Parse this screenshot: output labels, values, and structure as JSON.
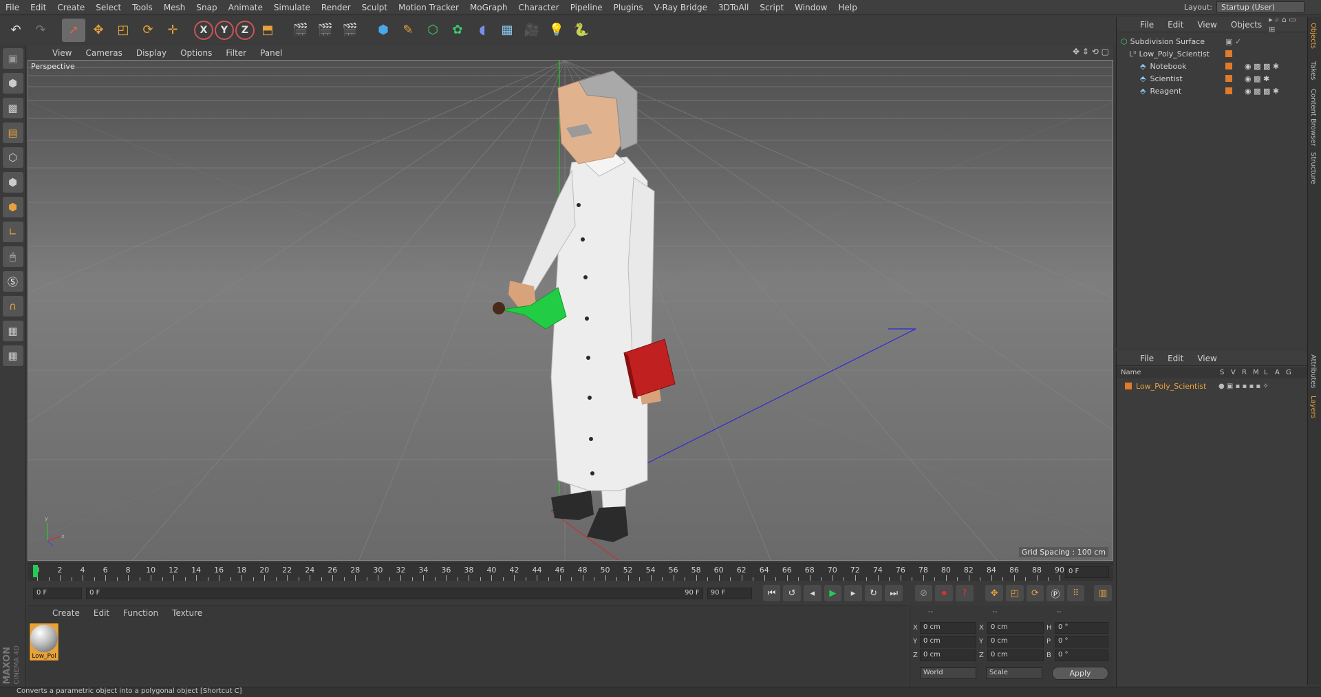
{
  "menu": [
    "File",
    "Edit",
    "Create",
    "Select",
    "Tools",
    "Mesh",
    "Snap",
    "Animate",
    "Simulate",
    "Render",
    "Sculpt",
    "Motion Tracker",
    "MoGraph",
    "Character",
    "Pipeline",
    "Plugins",
    "V-Ray Bridge",
    "3DToAll",
    "Script",
    "Window",
    "Help"
  ],
  "layout": {
    "label": "Layout:",
    "value": "Startup (User)"
  },
  "toolbar": {
    "axes": [
      "X",
      "Y",
      "Z"
    ]
  },
  "viewport": {
    "menu": [
      "View",
      "Cameras",
      "Display",
      "Options",
      "Filter",
      "Panel"
    ],
    "label": "Perspective",
    "grid_spacing": "Grid Spacing : 100 cm"
  },
  "timeline": {
    "ticks": [
      "0",
      "2",
      "4",
      "6",
      "8",
      "10",
      "12",
      "14",
      "16",
      "18",
      "20",
      "22",
      "24",
      "26",
      "28",
      "30",
      "32",
      "34",
      "36",
      "38",
      "40",
      "42",
      "44",
      "46",
      "48",
      "50",
      "52",
      "54",
      "56",
      "58",
      "60",
      "62",
      "64",
      "66",
      "68",
      "70",
      "72",
      "74",
      "76",
      "78",
      "80",
      "82",
      "84",
      "86",
      "88",
      "90"
    ],
    "current_frame": "0 F",
    "start_field": "0 F",
    "range_start": "0 F",
    "range_end": "90 F",
    "end_field": "90 F"
  },
  "material_panel": {
    "menu": [
      "Create",
      "Edit",
      "Function",
      "Texture"
    ],
    "materials": [
      {
        "label": "Low_Pol"
      }
    ]
  },
  "coords": {
    "header": [
      "--",
      "--",
      "--"
    ],
    "rows": [
      {
        "a": "X",
        "av": "0 cm",
        "b": "X",
        "bv": "0 cm",
        "c": "H",
        "cv": "0 °"
      },
      {
        "a": "Y",
        "av": "0 cm",
        "b": "Y",
        "bv": "0 cm",
        "c": "P",
        "cv": "0 °"
      },
      {
        "a": "Z",
        "av": "0 cm",
        "b": "Z",
        "bv": "0 cm",
        "c": "B",
        "cv": "0 °"
      }
    ],
    "world": "World",
    "scale": "Scale",
    "apply": "Apply"
  },
  "object_manager": {
    "menu": [
      "File",
      "Edit",
      "View",
      "Objects"
    ],
    "objects": [
      {
        "name": "Subdivision Surface",
        "indent": 0
      },
      {
        "name": "Low_Poly_Scientist",
        "indent": 1
      },
      {
        "name": "Notebook",
        "indent": 2
      },
      {
        "name": "Scientist",
        "indent": 2
      },
      {
        "name": "Reagent",
        "indent": 2
      }
    ]
  },
  "layer_manager": {
    "menu": [
      "File",
      "Edit",
      "View"
    ],
    "columns": [
      "Name",
      "S",
      "V",
      "R",
      "M",
      "L",
      "A",
      "G"
    ],
    "layers": [
      {
        "name": "Low_Poly_Scientist"
      }
    ]
  },
  "side_tabs": [
    "Objects",
    "Takes",
    "Content Browser",
    "Structure",
    "Attributes",
    "Layers"
  ],
  "status": "Converts a parametric object into a polygonal object [Shortcut C]",
  "logo": {
    "line1": "MAXON",
    "line2": "CINEMA 4D"
  },
  "colors": {
    "accent_orange": "#e8a23a",
    "layer_orange": "#e07b2a",
    "green_frame": "#22cc55"
  }
}
